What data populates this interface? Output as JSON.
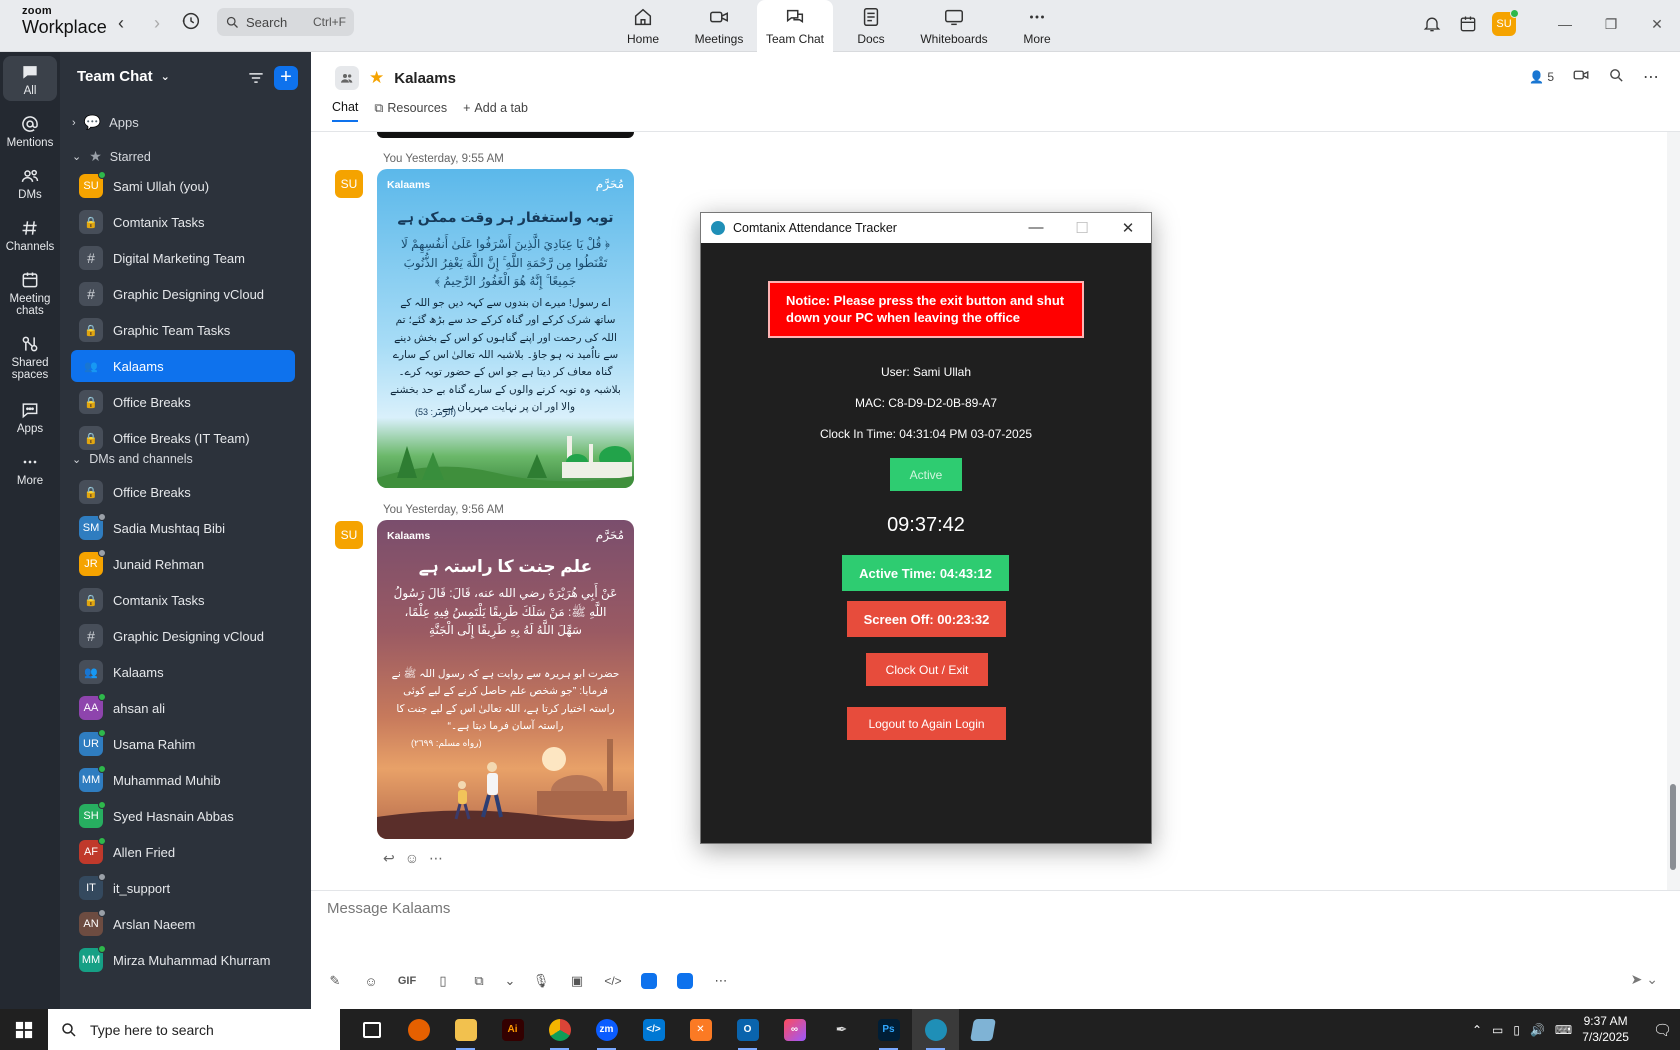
{
  "app": {
    "logo_line1": "zoom",
    "logo_line2": "Workplace",
    "search_placeholder": "Search",
    "search_shortcut": "Ctrl+F",
    "avatar_initials": "SU"
  },
  "top_tabs": [
    {
      "label": "Home",
      "icon": "home-icon"
    },
    {
      "label": "Meetings",
      "icon": "video-icon"
    },
    {
      "label": "Team Chat",
      "icon": "chat-icon",
      "active": true
    },
    {
      "label": "Docs",
      "icon": "doc-icon"
    },
    {
      "label": "Whiteboards",
      "icon": "whiteboard-icon"
    },
    {
      "label": "More",
      "icon": "more-icon"
    }
  ],
  "rail": [
    {
      "label": "All",
      "active": true
    },
    {
      "label": "Mentions"
    },
    {
      "label": "DMs"
    },
    {
      "label": "Channels"
    },
    {
      "label": "Meeting chats"
    },
    {
      "label": "Shared spaces"
    },
    {
      "label": "Apps"
    },
    {
      "label": "More"
    }
  ],
  "sidebar": {
    "title": "Team Chat",
    "sections": {
      "apps": "Apps",
      "starred": "Starred",
      "dms": "DMs and channels"
    },
    "starred": [
      {
        "label": "Sami Ullah (you)",
        "type": "avatar",
        "initials": "SU",
        "color": "#f5a300",
        "status": "online"
      },
      {
        "label": "Comtanix Tasks",
        "type": "lock"
      },
      {
        "label": "Digital Marketing Team",
        "type": "hash"
      },
      {
        "label": "Graphic Designing vCloud",
        "type": "hash"
      },
      {
        "label": "Graphic Team Tasks",
        "type": "lock"
      },
      {
        "label": "Kalaams",
        "type": "group",
        "active": true
      },
      {
        "label": "Office Breaks",
        "type": "lock"
      },
      {
        "label": "Office Breaks (IT Team)",
        "type": "lock"
      }
    ],
    "dms": [
      {
        "label": "Office Breaks",
        "type": "lock"
      },
      {
        "label": "Sadia Mushtaq Bibi",
        "type": "avatar",
        "initials": "SM",
        "color": "#2f7dc0",
        "status": "away"
      },
      {
        "label": "Junaid Rehman",
        "type": "avatar",
        "initials": "JR",
        "color": "#f5a300",
        "status": "away"
      },
      {
        "label": "Comtanix Tasks",
        "type": "lock"
      },
      {
        "label": "Graphic Designing vCloud",
        "type": "hash"
      },
      {
        "label": "Kalaams",
        "type": "group"
      },
      {
        "label": "ahsan ali",
        "type": "avatar",
        "initials": "AA",
        "color": "#8e44ad",
        "status": "online"
      },
      {
        "label": "Usama Rahim",
        "type": "avatar",
        "initials": "UR",
        "color": "#2f7dc0",
        "status": "online"
      },
      {
        "label": "Muhammad Muhib",
        "type": "avatar",
        "initials": "MM",
        "color": "#2f7dc0",
        "status": "online"
      },
      {
        "label": "Syed Hasnain Abbas",
        "type": "avatar",
        "initials": "SH",
        "color": "#27ae60",
        "status": "online"
      },
      {
        "label": "Allen Fried",
        "type": "avatar",
        "initials": "AF",
        "color": "#c0392b",
        "status": "online"
      },
      {
        "label": "it_support",
        "type": "avatar",
        "initials": "IT",
        "color": "#34495e",
        "status": "away"
      },
      {
        "label": "Arslan Naeem",
        "type": "avatar",
        "initials": "AN",
        "color": "#6d4c41",
        "status": "away"
      },
      {
        "label": "Mirza Muhammad Khurram",
        "type": "avatar",
        "initials": "MM",
        "color": "#16a085",
        "status": "online"
      }
    ]
  },
  "chat": {
    "title": "Kalaams",
    "member_count": "5",
    "tabs": [
      "Chat",
      "Resources",
      "Add a tab"
    ],
    "composer_placeholder": "Message Kalaams",
    "messages": [
      {
        "sender": "You",
        "time": "Yesterday, 9:55 AM",
        "avatar": "SU",
        "brand": "Kalaams",
        "month": "مُحَرَّم",
        "heading": "توبہ واستغفار ہر وقت ممکن ہے",
        "verse": "﴿ قُلْ يَا عِبَادِيَ الَّذِينَ أَسْرَفُوا عَلَىٰ أَنفُسِهِمْ لَا تَقْنَطُوا مِن رَّحْمَةِ اللَّهِ ۚ إِنَّ اللَّهَ يَغْفِرُ الذُّنُوبَ جَمِيعًا ۚ إِنَّهُ هُوَ الْغَفُورُ الرَّحِيمُ ﴾",
        "body": "اے رسول! میرے ان بندوں سے کہہ دیں جو اللہ کے ساتھ شرک کرکے اور گناہ کرکے حد سے بڑھ گئے؛ تم اللہ کی رحمت اور اپنے گناہوں کو اس کے بخش دینے سے نااُمید نہ ہو جاؤ۔ بلاشبہ اللہ تعالیٰ اس کے سارے گناہ معاف کر دیتا ہے جو اس کے حضور توبہ کرے۔ بلاشبہ وہ توبہ کرنے والوں کے سارے گناہ بے حد بخشنے والا اور ان پر نہایت مہربان ہے۔",
        "reference": "(الزمر: 53)"
      },
      {
        "sender": "You",
        "time": "Yesterday, 9:56 AM",
        "avatar": "SU",
        "brand": "Kalaams",
        "month": "مُحَرَّم",
        "heading": "علم جنت کا راستہ ہے",
        "verse": "عَنْ أَبِي هُرَيْرَةَ رضي الله عنه، قَالَ: قَالَ رَسُولُ اللَّهِ ﷺ: مَنْ سَلَكَ طَرِيقًا يَلْتَمِسُ فِيهِ عِلْمًا، سَهَّلَ اللَّهُ لَهُ بِهِ طَرِيقًا إِلَى الْجَنَّةِ",
        "body": "حضرت ابو ہریرہ سے روایت ہے کہ رسول اللہ ﷺ نے فرمایا: ”جو شخص علم حاصل کرنے کے لیے کوئی راستہ اختیار کرتا ہے، اللہ تعالیٰ اس کے لیے جنت کا راستہ آسان فرما دیتا ہے۔“",
        "reference": "(رواه مسلم: ٢٦٩٩)"
      }
    ]
  },
  "tracker": {
    "title": "Comtanix Attendance Tracker",
    "notice": "Notice: Please press the exit button and shut down your PC when leaving the office",
    "user": "User: Sami Ullah",
    "mac": "MAC: C8-D9-D2-0B-89-A7",
    "clock_in": "Clock In Time: 04:31:04 PM 03-07-2025",
    "status": "Active",
    "clock": "09:37:42",
    "active_time": "Active Time: 04:43:12",
    "screen_off": "Screen Off: 00:23:32",
    "clock_out": "Clock Out / Exit",
    "logout": "Logout to Again Login"
  },
  "taskbar": {
    "search_placeholder": "Type here to search",
    "time": "9:37 AM",
    "date": "7/3/2025"
  }
}
